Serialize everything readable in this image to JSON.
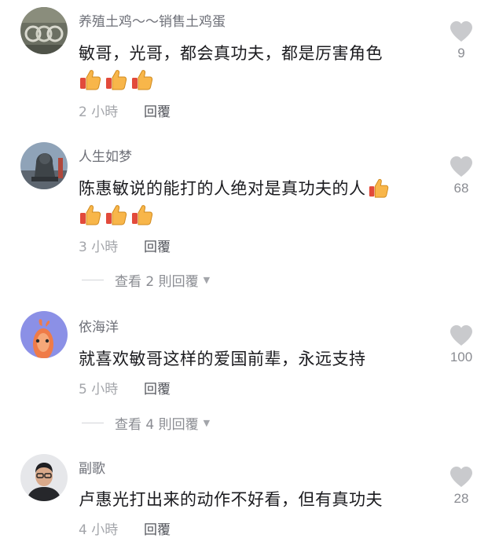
{
  "comments": [
    {
      "username": "养殖土鸡～～销售土鸡蛋",
      "text": "敏哥，光哥，都会真功夫，都是厉害角色",
      "time": "2 小時",
      "reply_label": "回覆",
      "likes": "9",
      "emoji": [
        "thumbs-up-icon",
        "thumbs-up-icon",
        "thumbs-up-icon"
      ]
    },
    {
      "username": "人生如梦",
      "text": "陈惠敏说的能打的人绝对是真功夫的人",
      "time": "3 小時",
      "reply_label": "回覆",
      "likes": "68",
      "inline_emoji": "thumbs-up-icon",
      "emoji": [
        "thumbs-up-icon",
        "thumbs-up-icon",
        "thumbs-up-icon"
      ],
      "expand_label": "查看 2 則回覆"
    },
    {
      "username": "依海洋",
      "text": "就喜欢敏哥这样的爱国前辈，永远支持",
      "time": "5 小時",
      "reply_label": "回覆",
      "likes": "100",
      "expand_label": "查看 4 則回覆"
    },
    {
      "username": "副歌",
      "text": "卢惠光打出来的动作不好看，但有真功夫",
      "time": "4 小時",
      "reply_label": "回覆",
      "likes": "28"
    }
  ],
  "colors": {
    "heart": "#c9cacd",
    "thumb_fill": "#f8b64a",
    "thumb_sleeve": "#e24a3b"
  }
}
